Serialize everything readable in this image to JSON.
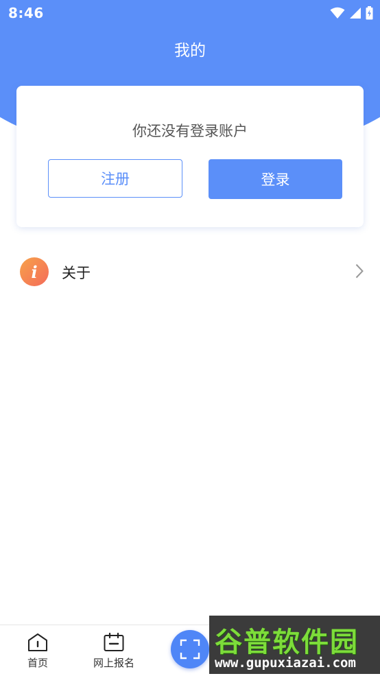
{
  "status_bar": {
    "time": "8:46",
    "icons": [
      "wifi-icon",
      "cellular-signal-icon",
      "battery-charging-icon"
    ]
  },
  "header": {
    "title": "我的"
  },
  "login_card": {
    "prompt": "你还没有登录账户",
    "register_label": "注册",
    "login_label": "登录"
  },
  "menu": {
    "items": [
      {
        "label": "关于",
        "icon": "info-icon"
      }
    ]
  },
  "tabbar": {
    "items": [
      {
        "label": "首页",
        "icon": "home-icon"
      },
      {
        "label": "网上报名",
        "icon": "calendar-icon"
      }
    ],
    "scan_icon": "scan-icon"
  },
  "watermark": {
    "title": "谷普软件园",
    "url": "www.gupuxiazai.com"
  },
  "colors": {
    "primary": "#5b8ff9",
    "about_icon_start": "#f7a24a",
    "about_icon_end": "#f46b5a"
  }
}
